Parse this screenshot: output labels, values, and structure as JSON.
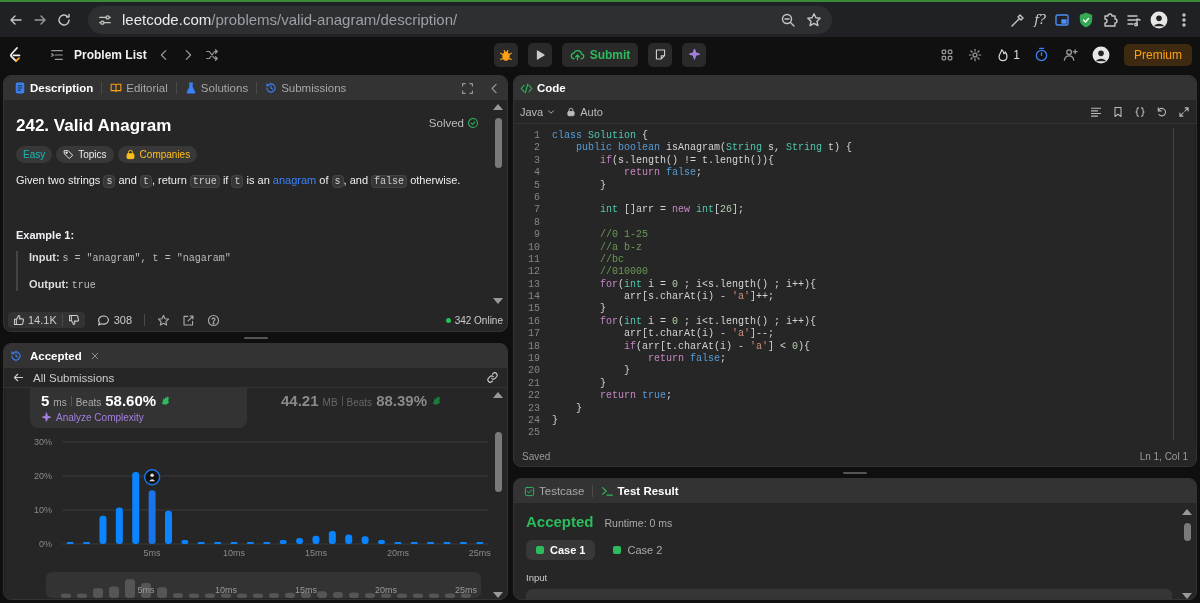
{
  "browser": {
    "url": {
      "domain": "leetcode.com",
      "path": "/problems/valid-anagram/description/"
    },
    "extension_label": "f?"
  },
  "nav": {
    "title": "Problem List",
    "submit": "Submit",
    "streak": "1",
    "premium": "Premium"
  },
  "description": {
    "tabs": [
      {
        "label": "Description",
        "selected": true
      },
      {
        "label": "Editorial",
        "selected": false
      },
      {
        "label": "Solutions",
        "selected": false
      },
      {
        "label": "Submissions",
        "selected": false
      }
    ],
    "title": "242. Valid Anagram",
    "status": "Solved",
    "tags": [
      {
        "label": "Easy",
        "kind": "difficulty"
      },
      {
        "label": "Topics",
        "kind": "topics"
      },
      {
        "label": "Companies",
        "kind": "companies"
      }
    ],
    "statement": [
      {
        "text": "Given two strings ",
        "kind": "text"
      },
      {
        "text": "s",
        "kind": "code"
      },
      {
        "text": " and ",
        "kind": "text"
      },
      {
        "text": "t",
        "kind": "code"
      },
      {
        "text": ", return ",
        "kind": "text"
      },
      {
        "text": "true",
        "kind": "code"
      },
      {
        "text": " if ",
        "kind": "text"
      },
      {
        "text": "t",
        "kind": "code"
      },
      {
        "text": " is an ",
        "kind": "text"
      },
      {
        "text": "anagram",
        "kind": "link"
      },
      {
        "text": " of ",
        "kind": "text"
      },
      {
        "text": "s",
        "kind": "code"
      },
      {
        "text": ", and ",
        "kind": "text"
      },
      {
        "text": "false",
        "kind": "code"
      },
      {
        "text": " otherwise.",
        "kind": "text"
      }
    ],
    "example": {
      "heading": "Example 1:",
      "input_label": "Input:",
      "input_value": "s = \"anagram\", t = \"nagaram\"",
      "output_label": "Output:",
      "output_value": "true"
    },
    "footer": {
      "likes": "14.1K",
      "comments": "308",
      "online": "342 Online"
    }
  },
  "submission": {
    "tab": "Accepted",
    "back": "All Submissions",
    "stats": [
      {
        "value": "5",
        "unit": "ms",
        "beats_label": "Beats",
        "beats": "58.60%",
        "selected": true
      },
      {
        "value": "44.21",
        "unit": "MB",
        "beats_label": "Beats",
        "beats": "88.39%",
        "selected": false
      }
    ],
    "analyze": "Analyze Complexity",
    "chart_data": {
      "type": "bar",
      "x": [
        0,
        1,
        2,
        3,
        4,
        5,
        6,
        7,
        8,
        9,
        10,
        11,
        12,
        13,
        14,
        15,
        16,
        17,
        18,
        19,
        20,
        21,
        22,
        23,
        24,
        25
      ],
      "values": [
        0.6,
        0.6,
        8.3,
        10.7,
        21.2,
        15.8,
        9.8,
        1.2,
        0.6,
        0.6,
        0.6,
        0.6,
        0.6,
        1.2,
        1.8,
        2.4,
        3.8,
        2.8,
        2.3,
        1.2,
        0.6,
        0.6,
        0.6,
        0.6,
        0.6,
        0.6
      ],
      "xlim": [
        -0.5,
        25.5
      ],
      "ylim": [
        0,
        30
      ],
      "yticks": [
        {
          "value": 0,
          "label": "0%"
        },
        {
          "value": 10,
          "label": "10%"
        },
        {
          "value": 20,
          "label": "20%"
        },
        {
          "value": 30,
          "label": "30%"
        }
      ],
      "xticks": [
        {
          "value": 5,
          "label": "5ms"
        },
        {
          "value": 10,
          "label": "10ms"
        },
        {
          "value": 15,
          "label": "15ms"
        },
        {
          "value": 20,
          "label": "20ms"
        },
        {
          "value": 25,
          "label": "25ms"
        }
      ]
    },
    "navigator_labels": [
      "5ms",
      "10ms",
      "15ms",
      "20ms",
      "25ms"
    ]
  },
  "editor": {
    "title": "Code",
    "language": "Java",
    "mode": "Auto",
    "lines": [
      {
        "number": "1",
        "tokens": [
          {
            "text": "class",
            "kind": "keyword"
          },
          {
            "text": " Solution",
            "kind": "type"
          },
          {
            "text": " {",
            "kind": "plain"
          }
        ]
      },
      {
        "number": "2",
        "tokens": [
          {
            "text": "    public boolean",
            "kind": "keyword"
          },
          {
            "text": " isAnagram(",
            "kind": "plain"
          },
          {
            "text": "String",
            "kind": "type"
          },
          {
            "text": " s, ",
            "kind": "plain"
          },
          {
            "text": "String",
            "kind": "type"
          },
          {
            "text": " t) {",
            "kind": "plain"
          }
        ]
      },
      {
        "number": "3",
        "tokens": [
          {
            "text": "        if",
            "kind": "control"
          },
          {
            "text": "(s.length() != t.length()){",
            "kind": "plain"
          }
        ]
      },
      {
        "number": "4",
        "tokens": [
          {
            "text": "            return",
            "kind": "control"
          },
          {
            "text": " false",
            "kind": "keyword"
          },
          {
            "text": ";",
            "kind": "plain"
          }
        ]
      },
      {
        "number": "5",
        "tokens": [
          {
            "text": "        }",
            "kind": "plain"
          }
        ]
      },
      {
        "number": "6"
      },
      {
        "number": "7",
        "tokens": [
          {
            "text": "        int",
            "kind": "type"
          },
          {
            "text": " []arr = ",
            "kind": "plain"
          },
          {
            "text": "new",
            "kind": "control"
          },
          {
            "text": " int",
            "kind": "type"
          },
          {
            "text": "[",
            "kind": "plain"
          },
          {
            "text": "26",
            "kind": "number"
          },
          {
            "text": "];",
            "kind": "plain"
          }
        ]
      },
      {
        "number": "8"
      },
      {
        "number": "9",
        "tokens": [
          {
            "text": "        //0 1-25",
            "kind": "comment"
          }
        ]
      },
      {
        "number": "10",
        "tokens": [
          {
            "text": "        //a b-z",
            "kind": "comment"
          }
        ]
      },
      {
        "number": "11",
        "tokens": [
          {
            "text": "        //bc",
            "kind": "comment"
          }
        ]
      },
      {
        "number": "12",
        "tokens": [
          {
            "text": "        //010000",
            "kind": "comment"
          }
        ]
      },
      {
        "number": "13",
        "tokens": [
          {
            "text": "        for",
            "kind": "control"
          },
          {
            "text": "(",
            "kind": "plain"
          },
          {
            "text": "int",
            "kind": "type"
          },
          {
            "text": " i = ",
            "kind": "plain"
          },
          {
            "text": "0",
            "kind": "number"
          },
          {
            "text": " ; i<s.length() ; i++){",
            "kind": "plain"
          }
        ]
      },
      {
        "number": "14",
        "tokens": [
          {
            "text": "            arr[s.charAt(i) - ",
            "kind": "plain"
          },
          {
            "text": "'a'",
            "kind": "string"
          },
          {
            "text": "]++;",
            "kind": "plain"
          }
        ]
      },
      {
        "number": "15",
        "tokens": [
          {
            "text": "        }",
            "kind": "plain"
          }
        ]
      },
      {
        "number": "16",
        "tokens": [
          {
            "text": "        for",
            "kind": "control"
          },
          {
            "text": "(",
            "kind": "plain"
          },
          {
            "text": "int",
            "kind": "type"
          },
          {
            "text": " i = ",
            "kind": "plain"
          },
          {
            "text": "0",
            "kind": "number"
          },
          {
            "text": " ; i<t.length() ; i++){",
            "kind": "plain"
          }
        ]
      },
      {
        "number": "17",
        "tokens": [
          {
            "text": "            arr[t.charAt(i) - ",
            "kind": "plain"
          },
          {
            "text": "'a'",
            "kind": "string"
          },
          {
            "text": "]--;",
            "kind": "plain"
          }
        ]
      },
      {
        "number": "18",
        "tokens": [
          {
            "text": "            if",
            "kind": "control"
          },
          {
            "text": "(arr[t.charAt(i) - ",
            "kind": "plain"
          },
          {
            "text": "'a'",
            "kind": "string"
          },
          {
            "text": "] < ",
            "kind": "plain"
          },
          {
            "text": "0",
            "kind": "number"
          },
          {
            "text": "){",
            "kind": "plain"
          }
        ]
      },
      {
        "number": "19",
        "tokens": [
          {
            "text": "                return",
            "kind": "control"
          },
          {
            "text": " false",
            "kind": "keyword"
          },
          {
            "text": ";",
            "kind": "plain"
          }
        ]
      },
      {
        "number": "20",
        "tokens": [
          {
            "text": "            }",
            "kind": "plain"
          }
        ]
      },
      {
        "number": "21",
        "tokens": [
          {
            "text": "        }",
            "kind": "plain"
          }
        ]
      },
      {
        "number": "22",
        "tokens": [
          {
            "text": "        return",
            "kind": "control"
          },
          {
            "text": " true",
            "kind": "keyword"
          },
          {
            "text": ";",
            "kind": "plain"
          }
        ]
      },
      {
        "number": "23",
        "tokens": [
          {
            "text": "    }",
            "kind": "plain"
          }
        ]
      },
      {
        "number": "24",
        "tokens": [
          {
            "text": "}",
            "kind": "plain"
          }
        ]
      },
      {
        "number": "25"
      }
    ],
    "status": "Saved",
    "cursor": "Ln 1, Col 1"
  },
  "tests": {
    "tabs": [
      {
        "label": "Testcase",
        "selected": false
      },
      {
        "label": "Test Result",
        "selected": true
      }
    ],
    "verdict": "Accepted",
    "runtime": "Runtime: 0 ms",
    "cases": [
      {
        "label": "Case 1",
        "selected": true
      },
      {
        "label": "Case 2",
        "selected": false
      }
    ],
    "input_label": "Input"
  }
}
